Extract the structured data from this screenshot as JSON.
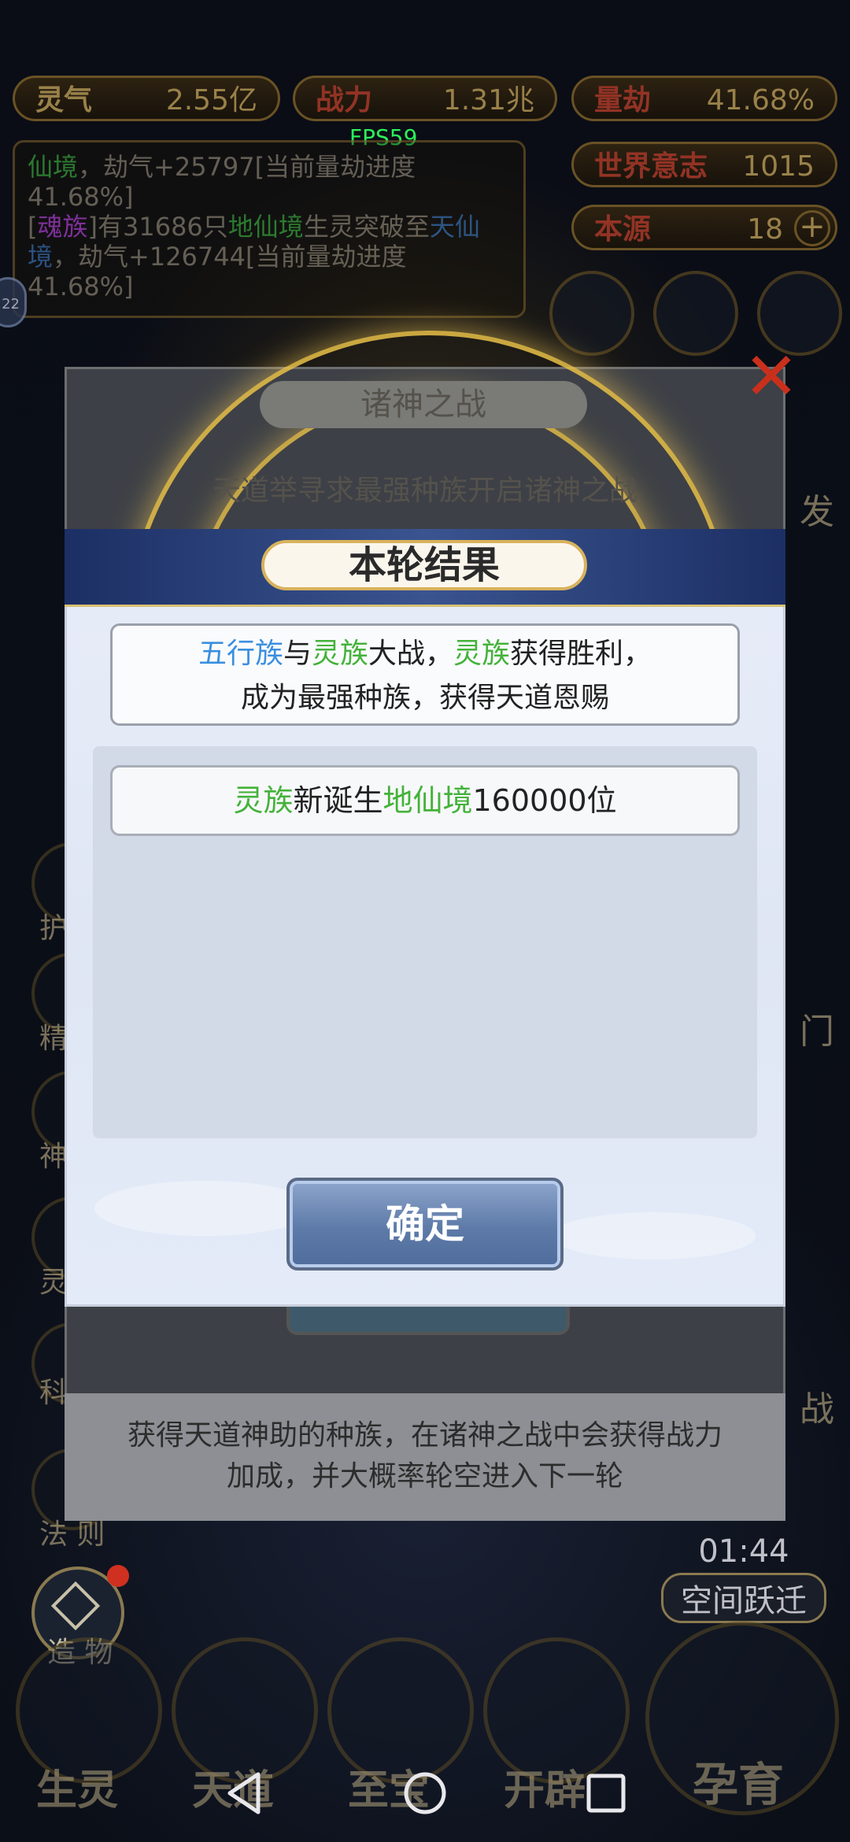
{
  "top_stats": [
    {
      "label": "灵气",
      "value": "2.55亿"
    },
    {
      "label": "战力",
      "value": "1.31兆"
    },
    {
      "label": "量劫",
      "value": "41.68%"
    },
    {
      "label": "世界意志",
      "value": "1015"
    },
    {
      "label": "本源",
      "value": "18"
    }
  ],
  "fps": "FPS59",
  "log": {
    "line1_a": "仙境",
    "line1_b": "，劫气+25797[当前量劫进度41.68%]",
    "line2_a": "[",
    "line2_race": "魂族",
    "line2_b": "]有31686只",
    "line2_realm": "地仙境",
    "line2_c": "生灵突破至",
    "line2_realm2": "天仙境",
    "line2_d": "，劫气+126744[当前量劫进度41.68%]"
  },
  "badge": "22",
  "background_panel": {
    "title": "诸神之战",
    "subtitle": "天道举寻求最强种族开启诸神之战",
    "footer_line1": "获得天道神助的种族，在诸神之战中会获得战力",
    "footer_line2": "加成，并大概率轮空进入下一轮",
    "side_right_1": "发",
    "side_right_2": "门",
    "side_right_3": "战"
  },
  "side_menu": [
    "护",
    "精",
    "神",
    "灵",
    "科",
    "法 则",
    "造 物"
  ],
  "timer": {
    "time": "01:44",
    "label": "空间跃迁"
  },
  "dialog": {
    "title": "本轮结果",
    "result": {
      "race1": "五行族",
      "conj": "与",
      "race2": "灵族",
      "battle": "大战，",
      "winner": "灵族",
      "win_text": "获得胜利，",
      "line2": "成为最强种族，获得天道恩赐"
    },
    "item": {
      "race": "灵族",
      "text1": "新诞生",
      "realm": "地仙境",
      "text2": "160000位"
    },
    "confirm_label": "确定"
  },
  "bottom_tabs": [
    "生灵",
    "天道",
    "至宝",
    "开辟",
    "孕育"
  ],
  "nav": [
    "back-icon",
    "home-icon",
    "recents-icon"
  ]
}
